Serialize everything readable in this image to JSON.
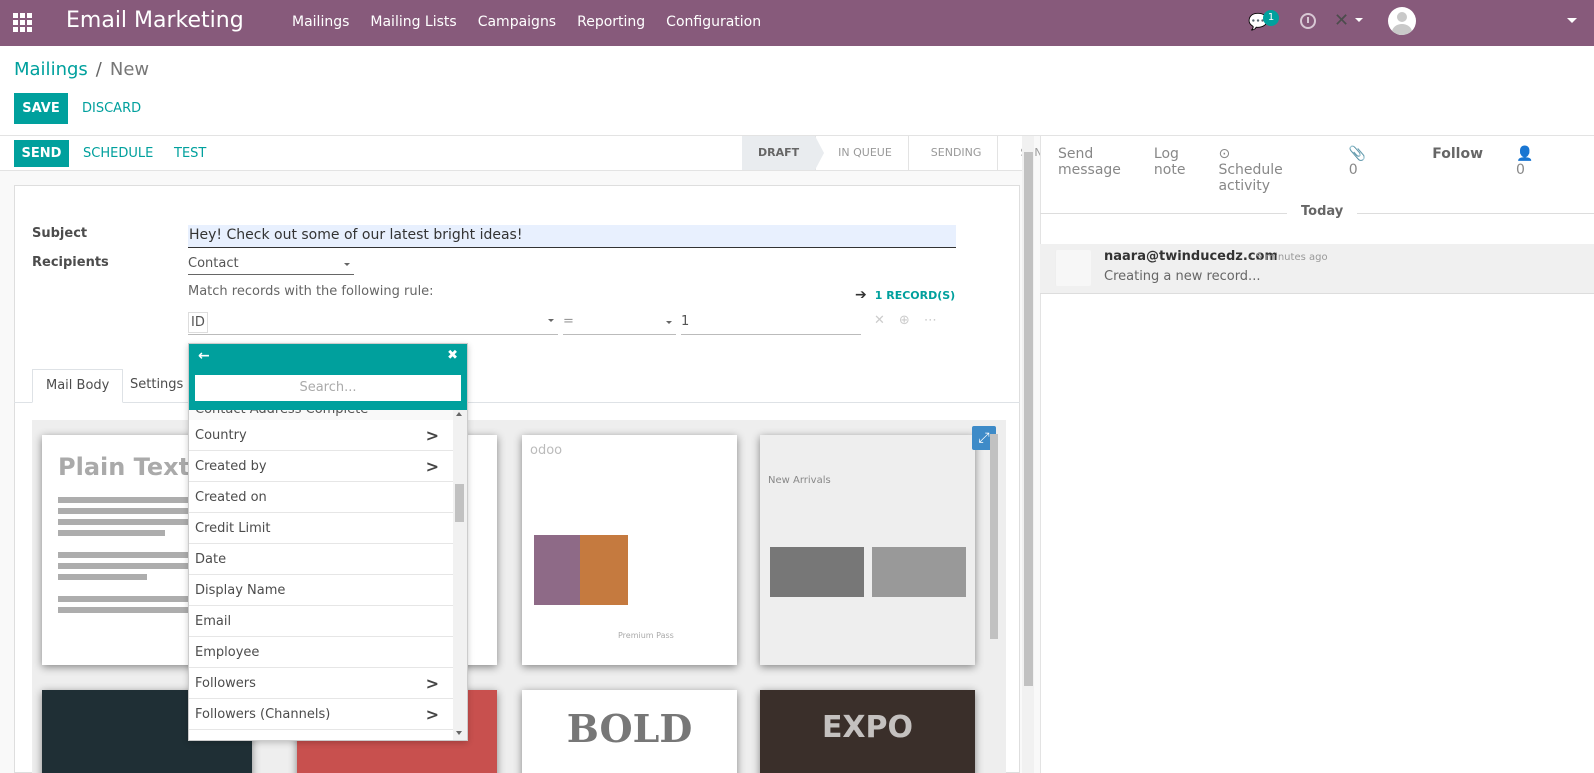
{
  "navbar": {
    "brand": "Email Marketing",
    "menu": [
      "Mailings",
      "Mailing Lists",
      "Campaigns",
      "Reporting",
      "Configuration"
    ],
    "chat_badge": "1",
    "color": "#875a7b"
  },
  "breadcrumb": {
    "parent": "Mailings",
    "separator": "/",
    "current": "New"
  },
  "buttons": {
    "save": "SAVE",
    "discard": "DISCARD",
    "send": "SEND",
    "schedule": "SCHEDULE",
    "test": "TEST"
  },
  "stages": [
    "DRAFT",
    "IN QUEUE",
    "SENDING",
    "SENT"
  ],
  "active_stage": "DRAFT",
  "form": {
    "subject_label": "Subject",
    "subject_value": "Hey! Check out some of our latest bright ideas!",
    "recipients_label": "Recipients",
    "recipients_value": "Contact",
    "match_text": "Match records with the following rule:",
    "records_link": "1 RECORD(S)",
    "rule_field": "ID",
    "rule_operator": "=",
    "rule_value": "1"
  },
  "tabs": [
    "Mail Body",
    "Settings"
  ],
  "field_selector": {
    "search_placeholder": "Search...",
    "partial_item": "Contact Address Complete",
    "items": [
      {
        "label": "Country",
        "has_children": true
      },
      {
        "label": "Created by",
        "has_children": true
      },
      {
        "label": "Created on",
        "has_children": false
      },
      {
        "label": "Credit Limit",
        "has_children": false
      },
      {
        "label": "Date",
        "has_children": false
      },
      {
        "label": "Display Name",
        "has_children": false
      },
      {
        "label": "Email",
        "has_children": false
      },
      {
        "label": "Employee",
        "has_children": false
      },
      {
        "label": "Followers",
        "has_children": true
      },
      {
        "label": "Followers (Channels)",
        "has_children": true
      }
    ]
  },
  "templates": {
    "plain_title": "Plain Text",
    "odoo_logo": "odoo",
    "arrivals_title": "New Arrivals",
    "premium": "Premium Pass",
    "bold_title": "BOLD",
    "expo_title": "EXPO"
  },
  "chatter": {
    "send_message": "Send message",
    "log_note": "Log note",
    "schedule_activity": "Schedule activity",
    "attachments_count": "0",
    "follow": "Follow",
    "followers_count": "0",
    "today": "Today",
    "message": {
      "author": "naara@twinducedz.com",
      "date": "- 5 minutes ago",
      "body": "Creating a new record..."
    }
  },
  "accent_color": "#00a09d"
}
